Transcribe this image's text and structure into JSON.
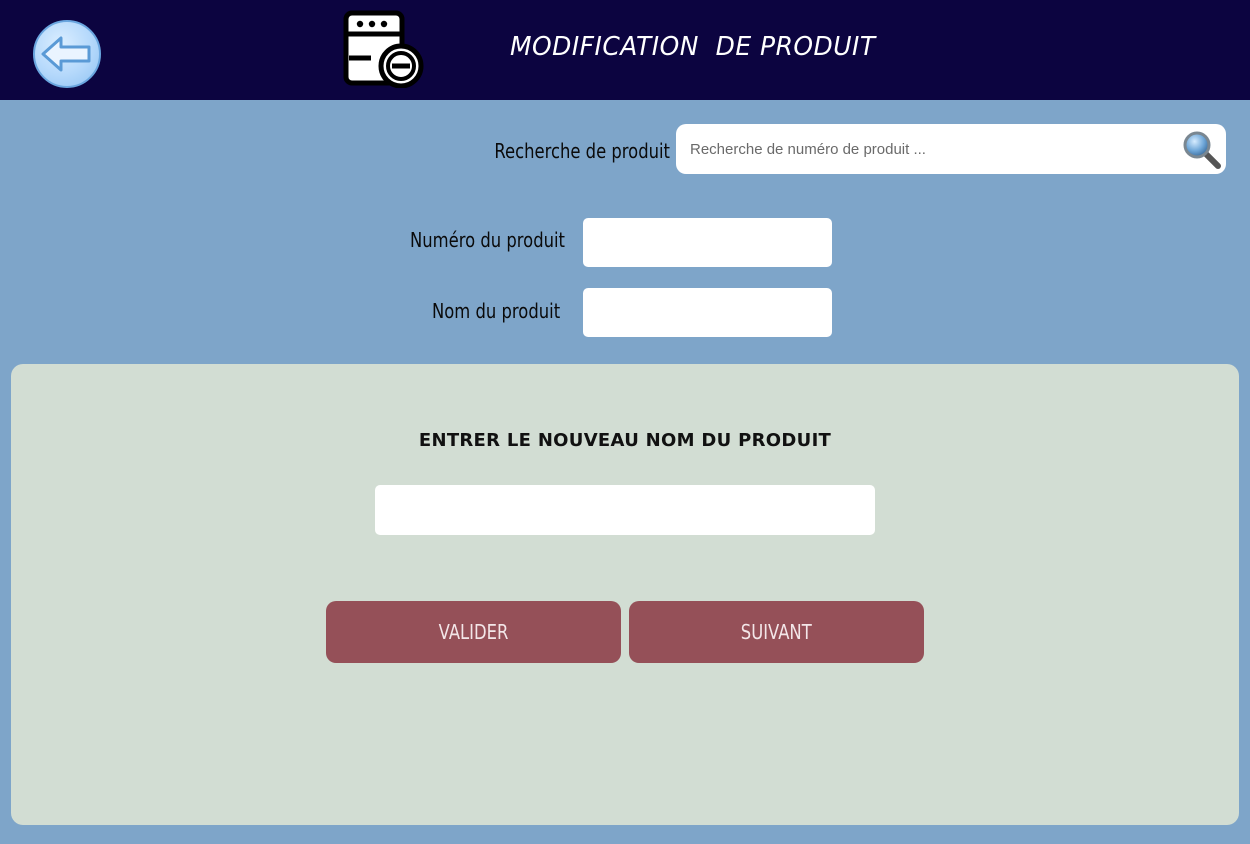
{
  "header": {
    "title": "MODIFICATION  DE PRODUIT",
    "background_color": "#0c0440",
    "back_icon": "back-arrow-icon",
    "product_icon": "product-remove-icon"
  },
  "search": {
    "label": "Recherche de produit",
    "placeholder": "Recherche de numéro de produit ...",
    "value": "",
    "icon": "search-icon"
  },
  "form": {
    "numero_label": "Numéro du produit",
    "numero_value": "",
    "nom_label": "Nom du produit",
    "nom_value": ""
  },
  "panel": {
    "title": "ENTRER LE NOUVEAU NOM DU PRODUIT",
    "new_name_value": "",
    "valider_label": "VALIDER",
    "suivant_label": "SUIVANT",
    "background_color": "#d2ddd3",
    "button_color": "#955058"
  },
  "page_background_color": "#7ea5c9"
}
